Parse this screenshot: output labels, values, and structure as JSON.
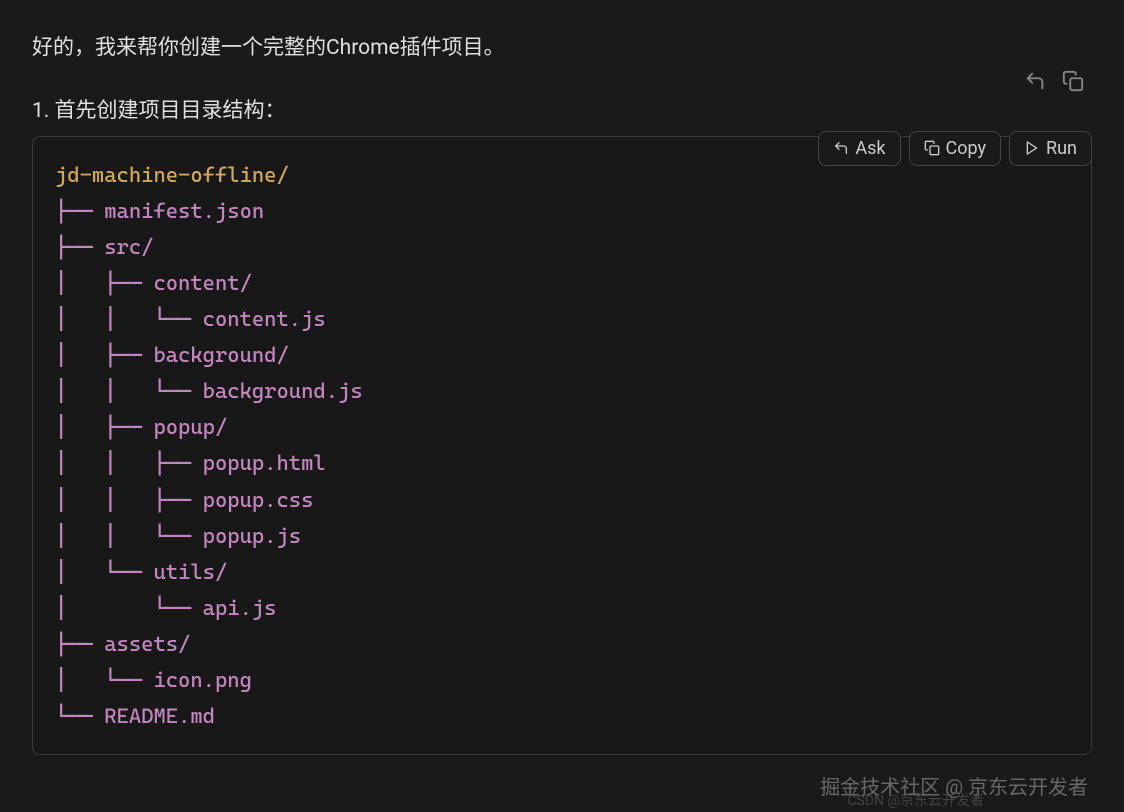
{
  "intro": "好的，我来帮你创建一个完整的Chrome插件项目。",
  "section_title": "1. 首先创建项目目录结构：",
  "actions": {
    "ask": "Ask",
    "copy": "Copy",
    "run": "Run"
  },
  "code": {
    "root": "jd-machine-offline/",
    "lines": [
      {
        "prefix": "├── ",
        "name": "manifest.json",
        "type": "file"
      },
      {
        "prefix": "├── ",
        "name": "src/",
        "type": "dir"
      },
      {
        "prefix": "│   ├── ",
        "name": "content/",
        "type": "dir"
      },
      {
        "prefix": "│   │   └── ",
        "name": "content.js",
        "type": "file"
      },
      {
        "prefix": "│   ├── ",
        "name": "background/",
        "type": "dir"
      },
      {
        "prefix": "│   │   └── ",
        "name": "background.js",
        "type": "file"
      },
      {
        "prefix": "│   ├── ",
        "name": "popup/",
        "type": "dir"
      },
      {
        "prefix": "│   │   ├── ",
        "name": "popup.html",
        "type": "file"
      },
      {
        "prefix": "│   │   ├── ",
        "name": "popup.css",
        "type": "file"
      },
      {
        "prefix": "│   │   └── ",
        "name": "popup.js",
        "type": "file"
      },
      {
        "prefix": "│   └── ",
        "name": "utils/",
        "type": "dir"
      },
      {
        "prefix": "│       └── ",
        "name": "api.js",
        "type": "file"
      },
      {
        "prefix": "├── ",
        "name": "assets/",
        "type": "dir"
      },
      {
        "prefix": "│   └── ",
        "name": "icon.png",
        "type": "file"
      },
      {
        "prefix": "└── ",
        "name": "README.md",
        "type": "file"
      }
    ]
  },
  "watermark_main": "掘金技术社区 @ 京东云开发者",
  "watermark_sub": "CSDN @京东云开发者"
}
